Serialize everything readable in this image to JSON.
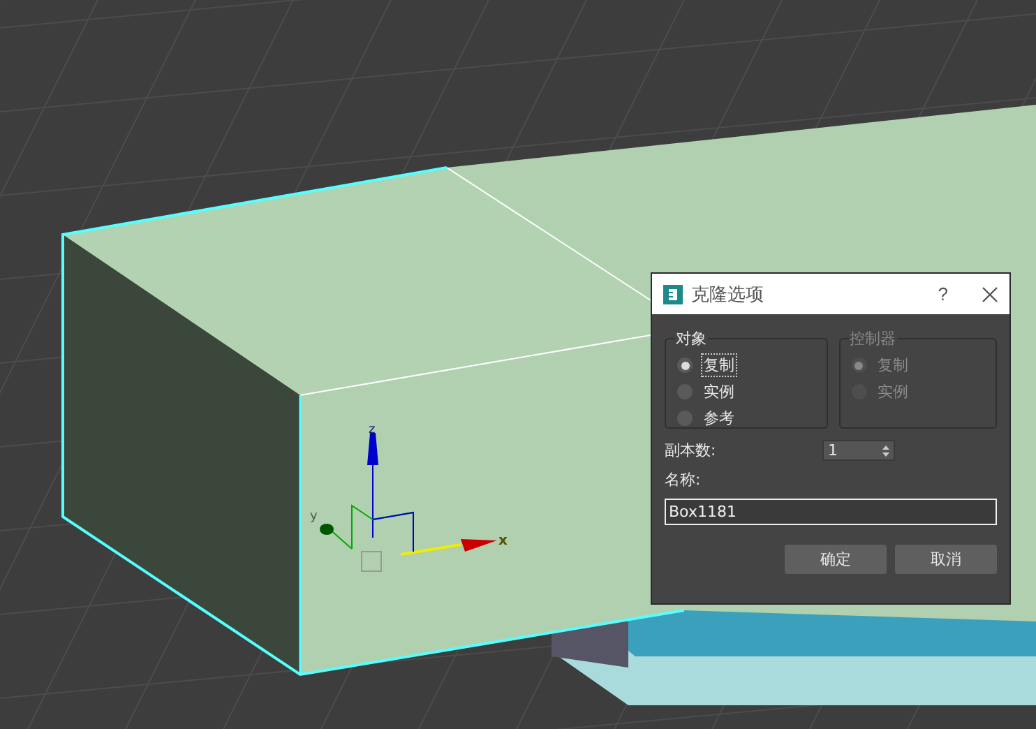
{
  "viewport": {
    "gizmo_axes": [
      "z",
      "y",
      "x"
    ]
  },
  "dialog": {
    "title": "克隆选项",
    "help": "?",
    "object_group": {
      "title": "对象",
      "options": [
        {
          "label": "复制",
          "selected": true
        },
        {
          "label": "实例",
          "selected": false
        },
        {
          "label": "参考",
          "selected": false
        }
      ]
    },
    "controller_group": {
      "title": "控制器",
      "disabled": true,
      "options": [
        {
          "label": "复制",
          "selected": true
        },
        {
          "label": "实例",
          "selected": false
        }
      ]
    },
    "copies": {
      "label": "副本数:",
      "value": "1"
    },
    "name": {
      "label": "名称:",
      "value": "Box1181"
    },
    "buttons": [
      "确定",
      "取消"
    ]
  }
}
